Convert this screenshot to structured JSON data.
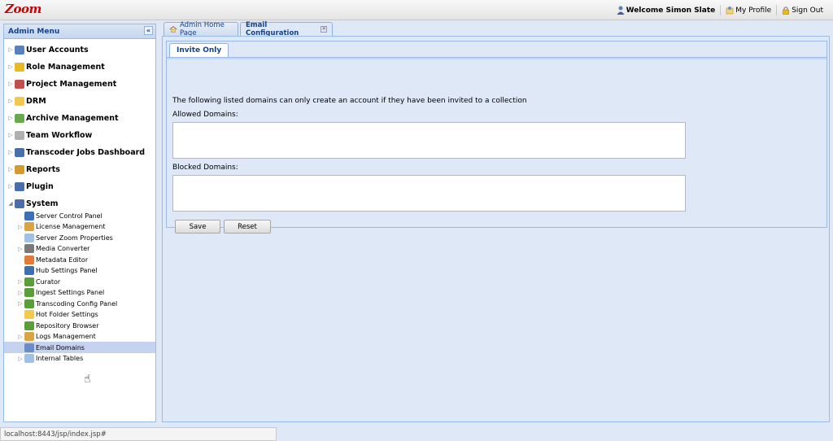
{
  "app": {
    "logo_text": "Zoom"
  },
  "topbar": {
    "welcome": "Welcome Simon Slate",
    "my_profile": "My Profile",
    "sign_out": "Sign Out"
  },
  "sidebar": {
    "title": "Admin Menu",
    "collapse_symbol": "«",
    "items": [
      {
        "label": "User Accounts",
        "icon": "user-icon",
        "color": "#5b7fb8"
      },
      {
        "label": "Role Management",
        "icon": "shield-icon",
        "color": "#e8b923"
      },
      {
        "label": "Project Management",
        "icon": "pie-chart-icon",
        "color": "#c0504d"
      },
      {
        "label": "DRM",
        "icon": "folder-icon",
        "color": "#f2c94c"
      },
      {
        "label": "Archive Management",
        "icon": "archive-icon",
        "color": "#6aa84f"
      },
      {
        "label": "Team Workflow",
        "icon": "cube-icon",
        "color": "#b0b0b0"
      },
      {
        "label": "Transcoder Jobs Dashboard",
        "icon": "monitor-icon",
        "color": "#4a6ea9"
      },
      {
        "label": "Reports",
        "icon": "report-icon",
        "color": "#d59b2d"
      },
      {
        "label": "Plugin",
        "icon": "monitor-icon",
        "color": "#4a6ea9"
      },
      {
        "label": "System",
        "icon": "monitor-icon",
        "color": "#4a6ea9"
      }
    ],
    "system_children": [
      {
        "label": "Server Control Panel",
        "icon": "monitor-icon",
        "color": "#3b6fb6",
        "expandable": false
      },
      {
        "label": "License Management",
        "icon": "document-icon",
        "color": "#d9a441",
        "expandable": true
      },
      {
        "label": "Server Zoom Properties",
        "icon": "properties-icon",
        "color": "#9fc0e8",
        "expandable": false
      },
      {
        "label": "Media Converter",
        "icon": "converter-icon",
        "color": "#7a7a7a",
        "expandable": true
      },
      {
        "label": "Metadata Editor",
        "icon": "editor-icon",
        "color": "#e07b39",
        "expandable": false
      },
      {
        "label": "Hub Settings Panel",
        "icon": "monitor-icon",
        "color": "#3b6fb6",
        "expandable": false
      },
      {
        "label": "Curator",
        "icon": "tree-icon",
        "color": "#5a9e3a",
        "expandable": true
      },
      {
        "label": "Ingest Settings Panel",
        "icon": "tree-icon",
        "color": "#5a9e3a",
        "expandable": true
      },
      {
        "label": "Transcoding Config Panel",
        "icon": "tree-icon",
        "color": "#5a9e3a",
        "expandable": true
      },
      {
        "label": "Hot Folder Settings",
        "icon": "folder-icon",
        "color": "#f2c94c",
        "expandable": false
      },
      {
        "label": "Repository Browser",
        "icon": "tree-icon",
        "color": "#5a9e3a",
        "expandable": false
      },
      {
        "label": "Logs Management",
        "icon": "document-icon",
        "color": "#d9a441",
        "expandable": true
      },
      {
        "label": "Email Domains",
        "icon": "email-domains-icon",
        "color": "#6b8cc4",
        "expandable": false,
        "selected": true
      },
      {
        "label": "Internal Tables",
        "icon": "table-icon",
        "color": "#9fc0e8",
        "expandable": true
      }
    ]
  },
  "tabs": [
    {
      "label": "Admin Home Page",
      "active": false
    },
    {
      "label": "Email Configuration",
      "active": true
    }
  ],
  "panel": {
    "inner_tab": "Invite Only",
    "description": "The following listed domains can only create an account if they have been invited to a collection",
    "allowed_label": "Allowed Domains:",
    "allowed_value": "",
    "blocked_label": "Blocked Domains:",
    "blocked_value": "",
    "save_label": "Save",
    "reset_label": "Reset"
  },
  "statusbar": {
    "url": "localhost:8443/jsp/index.jsp#"
  }
}
